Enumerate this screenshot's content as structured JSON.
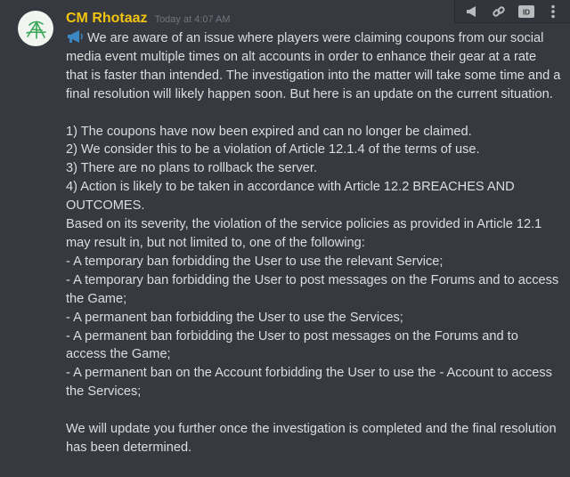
{
  "message": {
    "author": "CM Rhotaaz",
    "timestamp": "Today at 4:07 AM",
    "author_color": "#f1c40f",
    "emoji": "loudspeaker-emoji",
    "body": "We are aware of an issue where players were claiming coupons from our social media event multiple times on alt accounts in order to enhance their gear at a rate that is faster than intended. The investigation into the matter will take some time and a final resolution will likely happen soon. But here is an update on the current situation.\n\n1) The coupons have now been expired and can no longer be claimed.\n2) We consider this to be a violation of Article 12.1.4 of the terms of use.\n3) There are no plans to rollback the server.\n4) Action is likely to be taken in accordance with Article 12.2 BREACHES AND OUTCOMES.\nBased on its severity, the violation of the service policies as provided in Article 12.1 may result in, but not limited to, one of the following:\n- A temporary ban forbidding the User to use the relevant Service;\n- A temporary ban forbidding the User to post messages on the Forums and to access the Game;\n- A permanent ban forbidding the User to use the Services;\n- A permanent ban forbidding the User to post messages on the Forums and to access the Game;\n- A permanent ban on the Account forbidding the User to use the - Account to access the Services;\n\nWe will update you further once the investigation is completed and the final resolution has been determined."
  },
  "toolbar": {
    "icons": [
      "megaphone-icon",
      "link-icon",
      "id-icon",
      "more-icon"
    ],
    "id_label": "ID"
  },
  "colors": {
    "background": "#36393f",
    "text": "#dcddde",
    "timestamp": "#72767d",
    "emoji_blue": "#3b88c3"
  }
}
